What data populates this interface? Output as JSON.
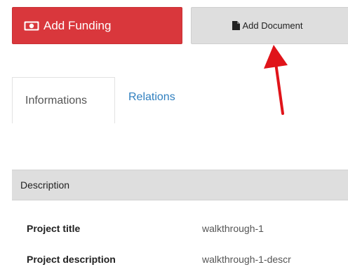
{
  "toolbar": {
    "add_funding_label": "Add Funding",
    "add_document_label": "Add Document",
    "funding_color": "#d9373c",
    "document_color": "#dedede"
  },
  "annotation": {
    "arrow_color": "#e0141a",
    "points_to": "add-document-button"
  },
  "tabs": [
    {
      "label": "Informations",
      "active": true
    },
    {
      "label": "Relations",
      "active": false
    }
  ],
  "section": {
    "title": "Description"
  },
  "fields": [
    {
      "label": "Project title",
      "value": "walkthrough-1"
    },
    {
      "label": "Project description",
      "value": "walkthrough-1-descr"
    }
  ],
  "icons": {
    "funding": "money-icon",
    "document": "file-icon"
  }
}
